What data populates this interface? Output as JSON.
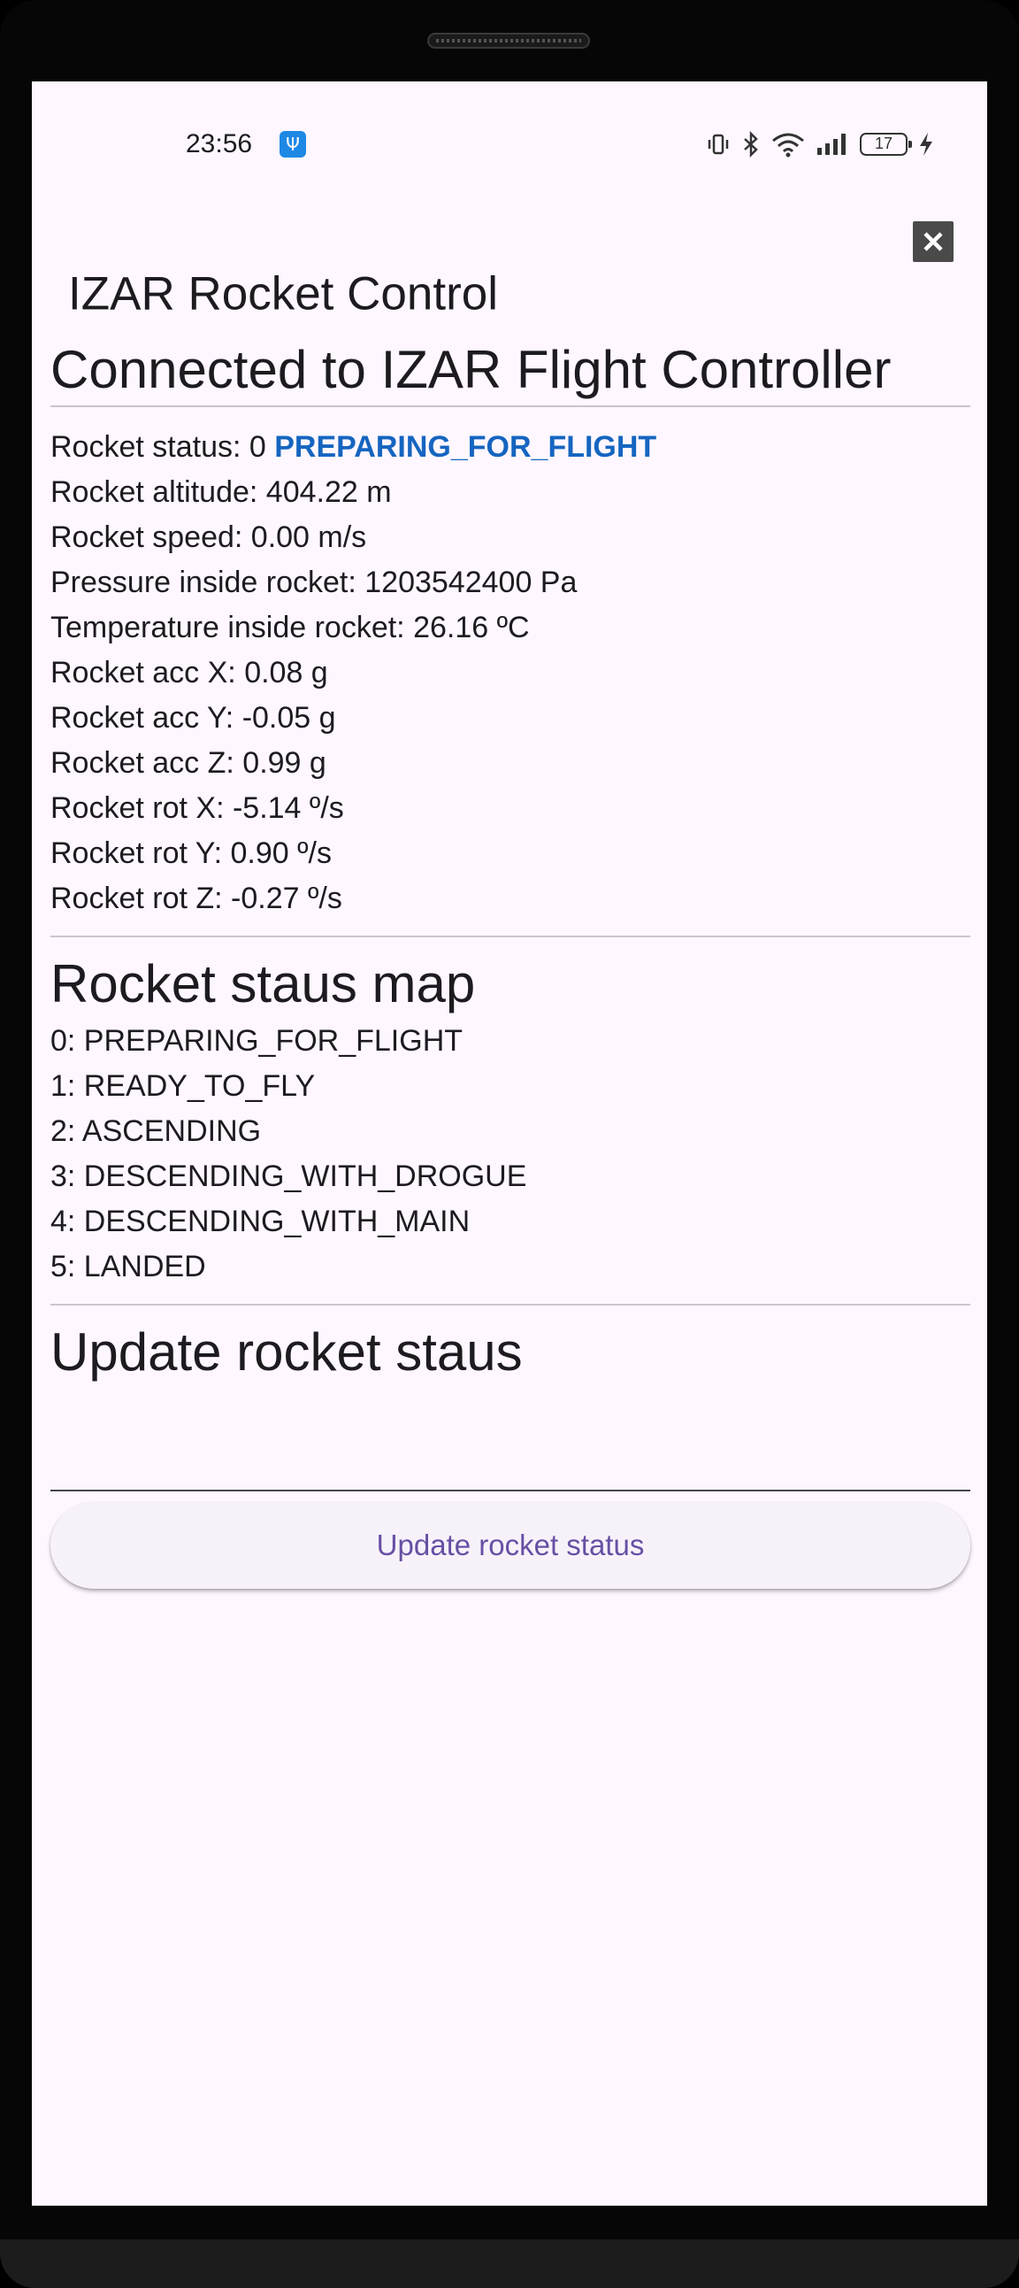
{
  "statusbar": {
    "time": "23:56",
    "battery_level": "17"
  },
  "appbar": {
    "title": "IZAR Rocket Control"
  },
  "main": {
    "connection_title": "Connected to IZAR Flight Controller",
    "telemetry": {
      "status_prefix": "Rocket status: 0 ",
      "status_value": "PREPARING_FOR_FLIGHT",
      "status_color": "#1565c0",
      "lines": [
        "Rocket altitude: 404.22 m",
        "Rocket speed: 0.00 m/s",
        "Pressure inside rocket: 1203542400 Pa",
        "Temperature inside rocket: 26.16 ºC",
        "Rocket acc X: 0.08 g",
        "Rocket acc Y: -0.05 g",
        "Rocket acc Z: 0.99 g",
        "Rocket rot X: -5.14 º/s",
        "Rocket rot Y: 0.90 º/s",
        "Rocket rot Z: -0.27 º/s"
      ]
    },
    "status_map": {
      "title": "Rocket staus map",
      "items": [
        "0: PREPARING_FOR_FLIGHT",
        "1: READY_TO_FLY",
        "2: ASCENDING",
        "3: DESCENDING_WITH_DROGUE",
        "4: DESCENDING_WITH_MAIN",
        "5: LANDED"
      ]
    },
    "update": {
      "title": "Update rocket staus",
      "input_value": "",
      "button_label": "Update rocket status",
      "accent_color": "#6750a4"
    }
  }
}
